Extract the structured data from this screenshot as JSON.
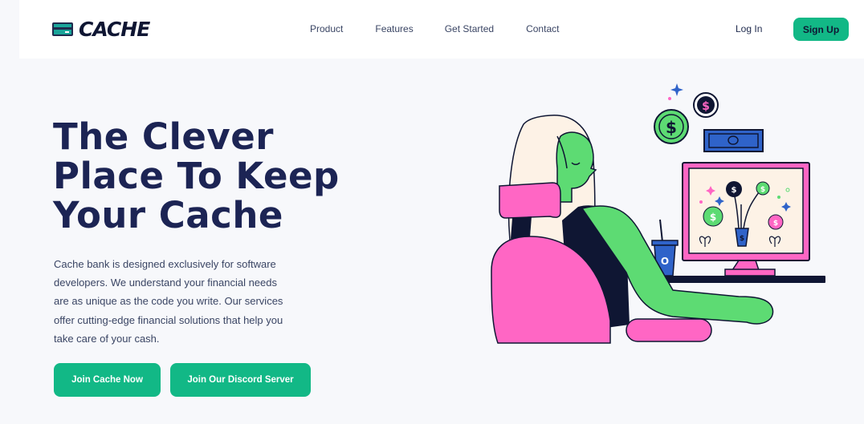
{
  "brand": {
    "name": "CACHE"
  },
  "nav": {
    "links": [
      "Product",
      "Features",
      "Get Started",
      "Contact"
    ],
    "login": "Log In",
    "signup": "Sign Up"
  },
  "hero": {
    "title_lines": [
      "The Clever",
      "Place To Keep",
      "Your Cache"
    ],
    "description": "Cache bank is designed exclusively for software developers. We understand your financial needs are as unique as the code you write. Our services offer cutting-edge financial solutions that help you take care of your cash.",
    "cta_primary": "Join Cache Now",
    "cta_secondary": "Join Our Discord Server"
  },
  "colors": {
    "accent": "#12b886",
    "heading": "#1c2454",
    "text": "#3a4564",
    "background": "#f7f8fb",
    "pink": "#ff66c4",
    "green": "#5ddb73"
  }
}
